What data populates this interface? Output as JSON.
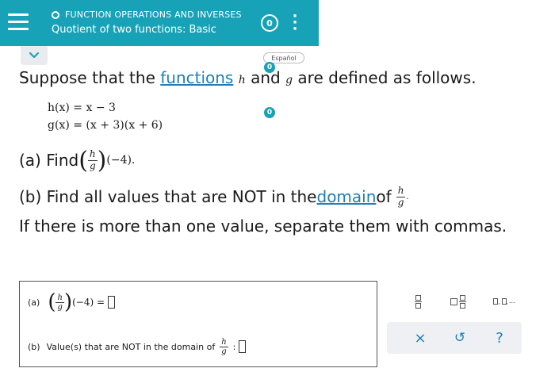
{
  "header": {
    "topic": "FUNCTION OPERATIONS AND INVERSES",
    "title": "Quotient of two functions: Basic",
    "counter": "0"
  },
  "espanol": {
    "label": "Español",
    "count": "0"
  },
  "problem": {
    "intro_pre": "Suppose that the ",
    "intro_link": "functions",
    "intro_h": "h",
    "intro_and": " and ",
    "intro_g": "g",
    "intro_post": " are defined as follows.",
    "h_def": "h(x) = x − 3",
    "g_def": "g(x) = (x + 3)(x + 6)",
    "def_count": "0",
    "part_a_label": "(a) Find ",
    "part_a_arg": "(−4).",
    "part_b_pre": "(b) Find all values that are NOT in the ",
    "part_b_link": "domain",
    "part_b_post": " of ",
    "instruction": "If there is more than one value, separate them with commas."
  },
  "frac_labels": {
    "num": "h",
    "den": "g"
  },
  "answer": {
    "a_label": "(a)",
    "a_arg": "(−4) =",
    "b_label": "(b)",
    "b_text": "Value(s) that are NOT in the domain of",
    "b_colon": ":"
  },
  "tools": {
    "ellipsis_label": "...",
    "clear": "×",
    "undo": "↺",
    "help": "?"
  },
  "colors": {
    "header_bg": "#17a2b8",
    "link": "#1e7fb8"
  }
}
